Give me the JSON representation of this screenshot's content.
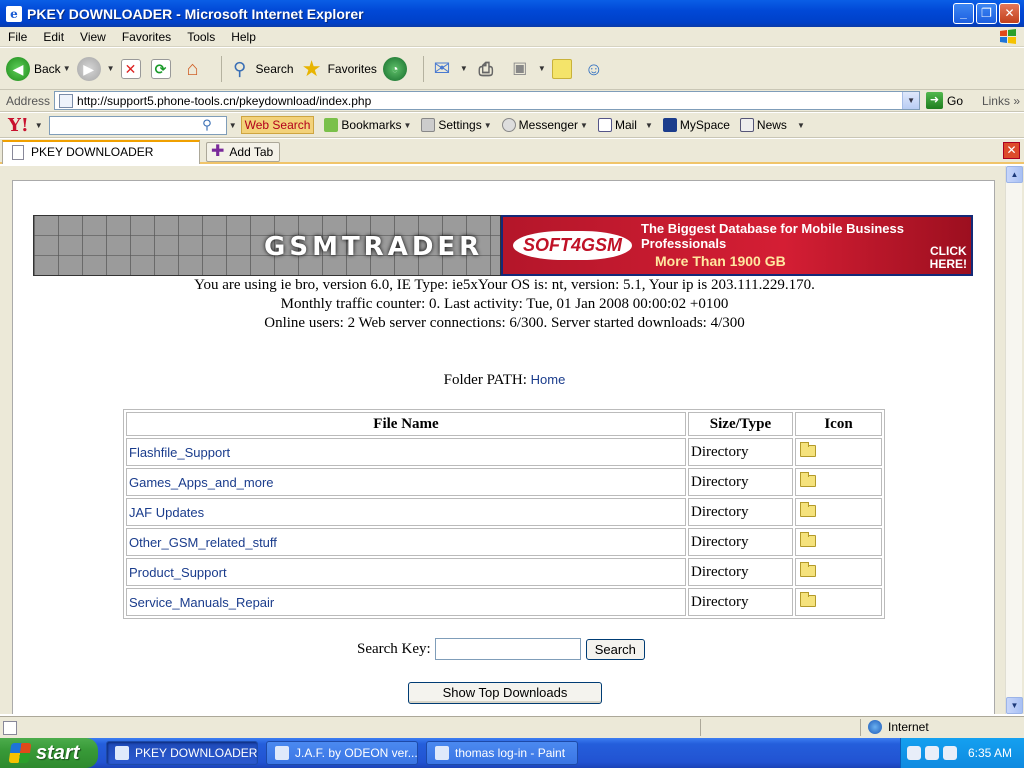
{
  "window": {
    "title": "PKEY DOWNLOADER - Microsoft Internet Explorer",
    "controls": {
      "minimize": "_",
      "maximize": "❐",
      "close": "✕"
    }
  },
  "menu": {
    "items": [
      "File",
      "Edit",
      "View",
      "Favorites",
      "Tools",
      "Help"
    ]
  },
  "toolbar": {
    "back_label": "Back",
    "search_label": "Search",
    "favorites_label": "Favorites"
  },
  "address": {
    "label": "Address",
    "url": "http://support5.phone-tools.cn/pkeydownload/index.php",
    "go_label": "Go",
    "links_label": "Links"
  },
  "yahoo_toolbar": {
    "logo": "Y!",
    "search_button": "Web Search",
    "bookmarks": "Bookmarks",
    "settings": "Settings",
    "messenger": "Messenger",
    "mail": "Mail",
    "myspace": "MySpace",
    "news": "News"
  },
  "tabs": {
    "active": "PKEY DOWNLOADER",
    "add_tab": "Add Tab"
  },
  "banner": {
    "left_logo": "GSMTRADER",
    "right_logo": "SOFT4GSM",
    "right_tagline": "The Biggest Database for Mobile Business Professionals",
    "right_subline": "More Than 1900 GB",
    "click_line1": "CLICK",
    "click_line2": "HERE!"
  },
  "page": {
    "info_line1": "You are using ie bro, version 6.0, IE Type: ie5xYour OS is: nt, version: 5.1, Your ip is 203.111.229.170.",
    "info_line2": "Monthly traffic counter: 0. Last activity: Tue, 01 Jan 2008 00:00:02 +0100",
    "info_line3": "Online users: 2 Web server connections: 6/300. Server started downloads: 4/300",
    "folder_path_label": "Folder PATH:",
    "folder_path_link": "Home",
    "table": {
      "headers": [
        "File Name",
        "Size/Type",
        "Icon"
      ],
      "rows": [
        {
          "name": "Flashfile_Support",
          "type": "Directory"
        },
        {
          "name": "Games_Apps_and_more",
          "type": "Directory"
        },
        {
          "name": "JAF Updates",
          "type": "Directory"
        },
        {
          "name": "Other_GSM_related_stuff",
          "type": "Directory"
        },
        {
          "name": "Product_Support",
          "type": "Directory"
        },
        {
          "name": "Service_Manuals_Repair",
          "type": "Directory"
        }
      ]
    },
    "search_label": "Search Key:",
    "search_value": "",
    "search_button": "Search",
    "top_downloads_button": "Show Top Downloads"
  },
  "status": {
    "zone": "Internet"
  },
  "taskbar": {
    "start": "start",
    "tasks": [
      "PKEY DOWNLOADER ...",
      "J.A.F. by ODEON ver...",
      "thomas log-in - Paint"
    ],
    "time": "6:35 AM"
  }
}
